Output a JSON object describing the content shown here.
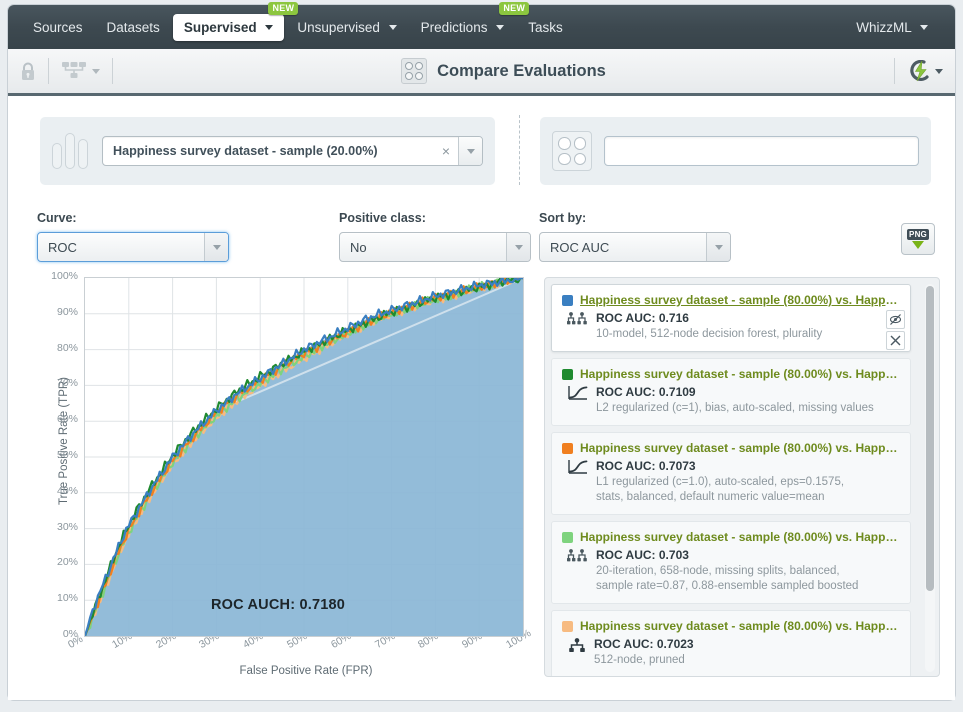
{
  "topnav": {
    "items": [
      {
        "label": "Sources",
        "has_caret": false,
        "new": false,
        "active": false
      },
      {
        "label": "Datasets",
        "has_caret": false,
        "new": false,
        "active": false
      },
      {
        "label": "Supervised",
        "has_caret": true,
        "new": true,
        "active": true
      },
      {
        "label": "Unsupervised",
        "has_caret": true,
        "new": false,
        "active": false
      },
      {
        "label": "Predictions",
        "has_caret": true,
        "new": true,
        "active": false
      },
      {
        "label": "Tasks",
        "has_caret": false,
        "new": false,
        "active": false
      }
    ],
    "new_badge": "NEW",
    "right_item": {
      "label": "WhizzML",
      "has_caret": true
    }
  },
  "titlebar": {
    "lock_icon": "lock-icon",
    "tree_icon": "sitemap-icon",
    "compare_icon": "compare-evaluations-icon",
    "title": "Compare Evaluations",
    "actions_icon": "lightning-bolt-icon"
  },
  "selectors": {
    "dataset_icon": "dataset-bars-icon",
    "dataset_value": "Happiness survey dataset - sample (20.00%)",
    "dataset_clear": "×",
    "evaluation_icon": "evaluations-grid-icon",
    "search_value": "",
    "search_placeholder": ""
  },
  "controls": {
    "curve": {
      "label": "Curve:",
      "value": "ROC"
    },
    "positive_class": {
      "label": "Positive class:",
      "value": "No"
    },
    "sort_by": {
      "label": "Sort by:",
      "value": "ROC AUC"
    },
    "export": {
      "icon": "png-download-icon",
      "label": "PNG"
    }
  },
  "chart_data": {
    "type": "line",
    "title": "",
    "xlabel": "False Positive Rate (FPR)",
    "ylabel": "True Positive Rate (TPR)",
    "xlim": [
      0,
      100
    ],
    "ylim": [
      0,
      100
    ],
    "grid": true,
    "legend_position": "external-right",
    "annotation": "ROC AUCH: 0.7180",
    "auch": 0.718,
    "xticks": [
      "0%",
      "10%",
      "20%",
      "30%",
      "40%",
      "50%",
      "60%",
      "70%",
      "80%",
      "90%",
      "100%"
    ],
    "yticks": [
      "0%",
      "10%",
      "20%",
      "30%",
      "40%",
      "50%",
      "60%",
      "70%",
      "80%",
      "90%",
      "100%"
    ],
    "hull_fill": "#8ab6d6",
    "x": [
      0,
      2,
      4,
      6,
      8,
      10,
      12,
      15,
      20,
      25,
      30,
      35,
      40,
      45,
      50,
      55,
      60,
      65,
      70,
      75,
      80,
      85,
      90,
      95,
      100
    ],
    "series": [
      {
        "name": "Happiness survey dataset - sample (80.00%) vs. Happine…",
        "color": "#3a7fc1",
        "auc": 0.716,
        "values": [
          0,
          8,
          14,
          20,
          26,
          31,
          35,
          41,
          50,
          57,
          63,
          68,
          72,
          76,
          80,
          83,
          86,
          89,
          91,
          93,
          95,
          96.5,
          98,
          99,
          100
        ]
      },
      {
        "name": "Happiness survey dataset - sample (80.00%) vs. Happine…",
        "color": "#1f8a2f",
        "auc": 0.7109,
        "values": [
          0,
          7,
          13.5,
          20,
          26,
          31,
          35.5,
          41.5,
          50.5,
          57.5,
          63.5,
          68.5,
          72.5,
          76,
          79.5,
          82.5,
          85.5,
          88,
          90.5,
          92.5,
          94.5,
          96,
          97.5,
          99,
          100
        ]
      },
      {
        "name": "Happiness survey dataset - sample (80.00%) vs. Happine…",
        "color": "#f07f20",
        "auc": 0.7073,
        "values": [
          0,
          6.5,
          12.5,
          18.5,
          24.5,
          29.5,
          34,
          40,
          49,
          56,
          62.5,
          67.5,
          71.5,
          75.5,
          79,
          82,
          85,
          88,
          90.5,
          92.5,
          94.5,
          96,
          97.5,
          99,
          100
        ]
      },
      {
        "name": "Happiness survey dataset - sample (80.00%) vs. Happine…",
        "color": "#7ed37e",
        "auc": 0.703,
        "values": [
          0,
          6,
          12,
          18,
          24,
          29,
          33.5,
          39.5,
          48.5,
          55.5,
          61.5,
          66.5,
          70.5,
          74.5,
          78,
          81.5,
          84.5,
          87.5,
          90,
          92,
          94,
          95.5,
          97.5,
          99,
          100
        ]
      },
      {
        "name": "Happiness survey dataset - sample (80.00%) vs. Happine…",
        "color": "#f7bb81",
        "auc": 0.7023,
        "values": [
          0,
          6,
          11.5,
          17.5,
          23.5,
          28.5,
          33,
          39,
          48,
          55,
          61,
          66,
          70,
          74,
          77.5,
          81,
          84.5,
          87.5,
          90,
          92,
          94,
          95.5,
          97.5,
          99,
          100
        ]
      }
    ]
  },
  "evaluations": {
    "scroll_position": "top",
    "items": [
      {
        "color": "#3a7fc1",
        "title": "Happiness survey dataset - sample (80.00%) vs. Happine…",
        "model_icon": "ensemble-icon",
        "metric": "ROC AUC: 0.716",
        "description": "10-model, 512-node decision forest, plurality",
        "active": true,
        "hide_label": "Ø",
        "remove_label": "✕"
      },
      {
        "color": "#1f8a2f",
        "title": "Happiness survey dataset - sample (80.00%) vs. Happine…",
        "model_icon": "logistic-regression-icon",
        "metric": "ROC AUC: 0.7109",
        "description": "L2 regularized (c=1), bias, auto-scaled, missing values",
        "active": false
      },
      {
        "color": "#f07f20",
        "title": "Happiness survey dataset - sample (80.00%) vs. Happine…",
        "model_icon": "logistic-regression-icon",
        "metric": "ROC AUC: 0.7073",
        "description": "L1 regularized (c=1.0), auto-scaled, eps=0.1575, stats, balanced, default numeric value=mean",
        "active": false
      },
      {
        "color": "#7ed37e",
        "title": "Happiness survey dataset - sample (80.00%) vs. Happine…",
        "model_icon": "ensemble-icon",
        "metric": "ROC AUC: 0.703",
        "description": "20-iteration, 658-node, missing splits, balanced, sample rate=0.87, 0.88-ensemble sampled boosted",
        "active": false
      },
      {
        "color": "#f7bb81",
        "title": "Happiness survey dataset - sample (80.00%) vs. Happine…",
        "model_icon": "decision-tree-icon",
        "metric": "ROC AUC: 0.7023",
        "description": "512-node, pruned",
        "active": false
      }
    ]
  }
}
